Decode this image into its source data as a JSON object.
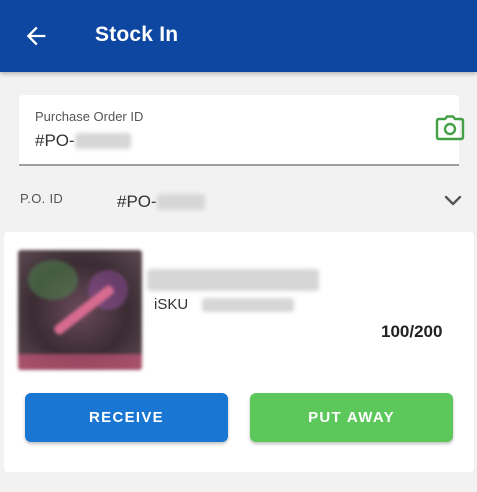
{
  "header": {
    "title": "Stock In",
    "background_color": "#0d47a1",
    "back_icon": "arrow-left-icon"
  },
  "purchase_order_field": {
    "label": "Purchase Order ID",
    "value_prefix": "#PO-",
    "camera_icon": "camera-icon",
    "camera_color": "#43a047"
  },
  "po_selector": {
    "label": "P.O. ID",
    "value_prefix": "#PO-",
    "expand_icon": "chevron-down-icon"
  },
  "item_card": {
    "isku_label": "iSKU",
    "quantity": "100/200",
    "receive_label": "RECEIVE",
    "put_away_label": "PUT AWAY",
    "receive_color": "#1976d2",
    "put_away_color": "#5cc85c"
  }
}
